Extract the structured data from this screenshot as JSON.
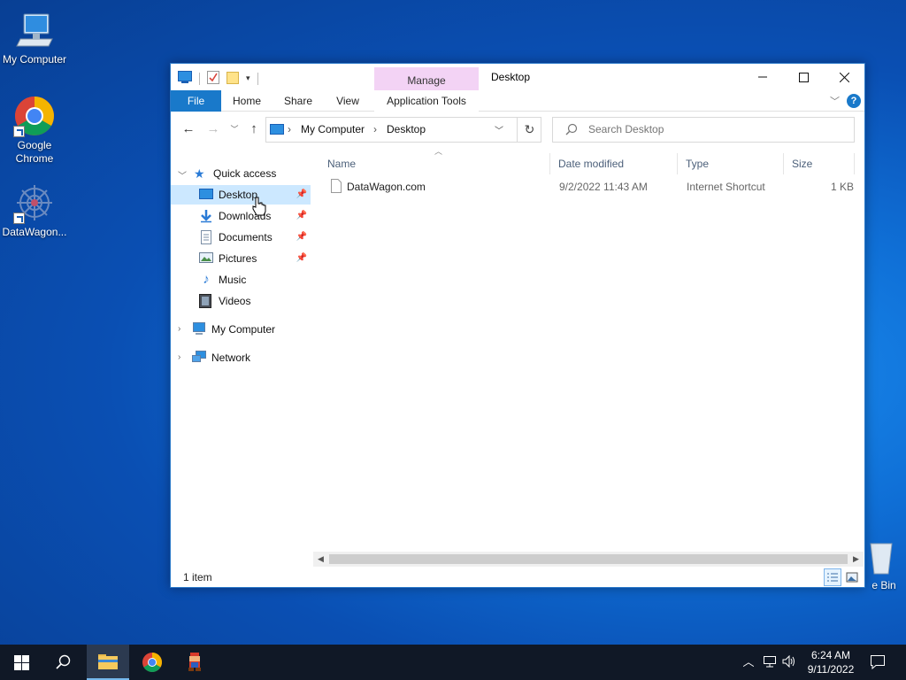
{
  "desktop": {
    "icons": [
      {
        "label": "My Computer"
      },
      {
        "label": "Google\nChrome"
      },
      {
        "label": "DataWagon..."
      },
      {
        "label": "e Bin"
      }
    ]
  },
  "window": {
    "title": "Desktop",
    "contextual_tab_group": "Manage",
    "ribbon_tabs": [
      "File",
      "Home",
      "Share",
      "View",
      "Application Tools"
    ],
    "help_label": "?",
    "address": {
      "crumbs": [
        "My Computer",
        "Desktop"
      ]
    },
    "search": {
      "placeholder": "Search Desktop"
    },
    "nav": {
      "quick_access": "Quick access",
      "items": [
        {
          "label": "Desktop",
          "icon": "desktop-icon",
          "pinned": true
        },
        {
          "label": "Downloads",
          "icon": "download-icon",
          "pinned": true
        },
        {
          "label": "Documents",
          "icon": "documents-icon",
          "pinned": true
        },
        {
          "label": "Pictures",
          "icon": "pictures-icon",
          "pinned": true
        },
        {
          "label": "Music",
          "icon": "music-icon",
          "pinned": false
        },
        {
          "label": "Videos",
          "icon": "videos-icon",
          "pinned": false
        }
      ],
      "my_computer": "My Computer",
      "network": "Network"
    },
    "columns": [
      "Name",
      "Date modified",
      "Type",
      "Size"
    ],
    "files": [
      {
        "name": "DataWagon.com",
        "date_modified": "9/2/2022 11:43 AM",
        "type": "Internet Shortcut",
        "size": "1 KB"
      }
    ],
    "status": "1 item"
  },
  "taskbar": {
    "clock_time": "6:24 AM",
    "clock_date": "9/11/2022"
  },
  "colors": {
    "accent": "#1979ca",
    "selection": "#cce8ff",
    "manage_tab": "#f3d3f5",
    "taskbar": "#101826"
  }
}
